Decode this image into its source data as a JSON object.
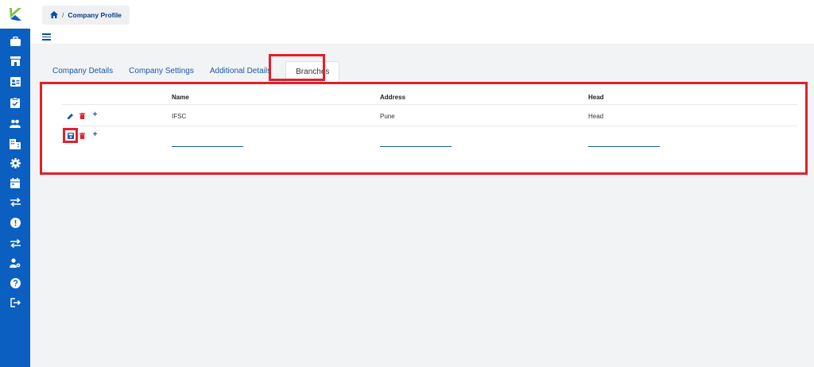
{
  "app": {
    "brand_color": "#0b5fc1",
    "highlight_color": "#e0202a"
  },
  "sidebar": {
    "items": [
      {
        "icon": "briefcase-icon"
      },
      {
        "icon": "store-icon"
      },
      {
        "icon": "id-card-icon"
      },
      {
        "icon": "clipboard-check-icon"
      },
      {
        "icon": "users-icon"
      },
      {
        "icon": "building-icon"
      },
      {
        "icon": "gear-icon"
      },
      {
        "icon": "calendar-icon"
      },
      {
        "icon": "transfer-icon"
      },
      {
        "icon": "alert-icon"
      },
      {
        "icon": "transfer-icon"
      },
      {
        "icon": "user-settings-icon"
      },
      {
        "icon": "help-icon"
      },
      {
        "icon": "logout-icon"
      }
    ]
  },
  "breadcrumb": {
    "separator": "/",
    "current": "Company Profile"
  },
  "tabs": [
    {
      "label": "Company Details"
    },
    {
      "label": "Company Settings"
    },
    {
      "label": "Additional Details"
    },
    {
      "label": "Branches",
      "active": true
    }
  ],
  "table": {
    "columns": [
      "Name",
      "Address",
      "Head"
    ],
    "rows": [
      {
        "name": "IFSC",
        "address": "Pune",
        "head": "Head"
      }
    ],
    "new_row": {
      "name": "",
      "address": "",
      "head": ""
    }
  }
}
